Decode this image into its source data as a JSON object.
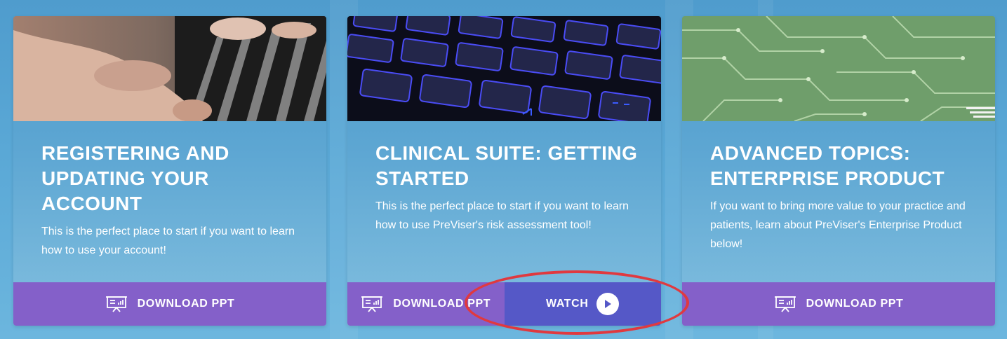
{
  "cards": [
    {
      "image_label": "hands-on-keyboard-photo",
      "title": "REGISTERING AND UPDATING YOUR ACCOUNT",
      "description": "This is the perfect place to start if you want to learn how to use your account!",
      "download_label": "DOWNLOAD PPT"
    },
    {
      "image_label": "blue-backlit-keyboard-photo",
      "title": "CLINICAL SUITE: GETTING STARTED",
      "description": "This is the perfect place to start if you want to learn how to use PreViser's risk assessment tool!",
      "download_label": "DOWNLOAD PPT",
      "watch_label": "WATCH"
    },
    {
      "image_label": "green-circuit-board-photo",
      "title": "ADVANCED TOPICS: ENTERPRISE PRODUCT",
      "description": "If you want to bring more value to your practice and patients, learn about PreViser's Enterprise Product below!",
      "download_label": "DOWNLOAD PPT"
    }
  ],
  "icons": {
    "download": "presentation-chart-icon",
    "watch": "play-icon"
  },
  "colors": {
    "download_button": "#8460c9",
    "watch_button": "#5558c7",
    "highlight": "#e0393f",
    "card_title": "#ffffff"
  },
  "annotation": {
    "highlighted_element": "watch-button"
  }
}
